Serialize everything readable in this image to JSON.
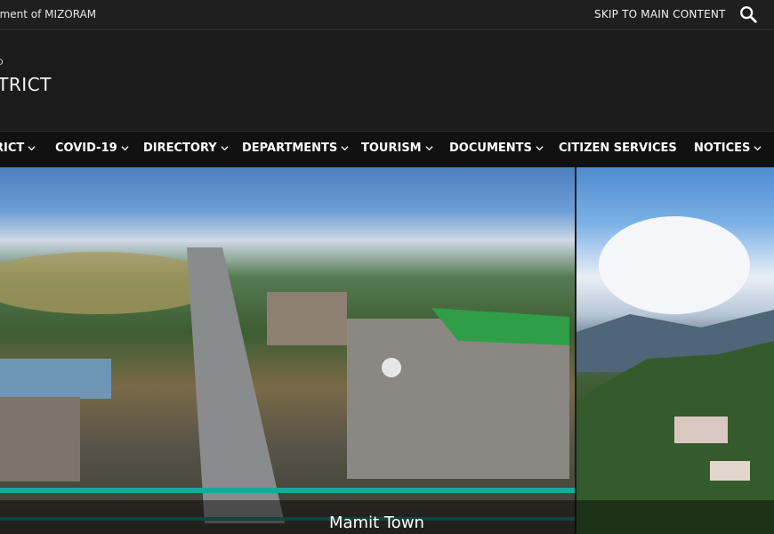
{
  "topbar": {
    "government": "nment of MIZORAM",
    "skip_link": "SKIP TO MAIN CONTENT",
    "search_icon": "search-icon"
  },
  "header": {
    "small_label": "D",
    "district_title": "STRICT"
  },
  "nav": {
    "items": [
      {
        "label": "RICT",
        "dropdown": true
      },
      {
        "label": "COVID-19",
        "dropdown": true
      },
      {
        "label": "DIRECTORY",
        "dropdown": true
      },
      {
        "label": "DEPARTMENTS",
        "dropdown": true
      },
      {
        "label": "TOURISM",
        "dropdown": true
      },
      {
        "label": "DOCUMENTS",
        "dropdown": true
      },
      {
        "label": "CITIZEN SERVICES",
        "dropdown": false
      },
      {
        "label": "NOTICES",
        "dropdown": true
      }
    ]
  },
  "hero": {
    "caption": "Mamit Town"
  },
  "colors": {
    "background": "#1b1b1b",
    "nav_background": "#111111",
    "text": "#ffffff"
  }
}
